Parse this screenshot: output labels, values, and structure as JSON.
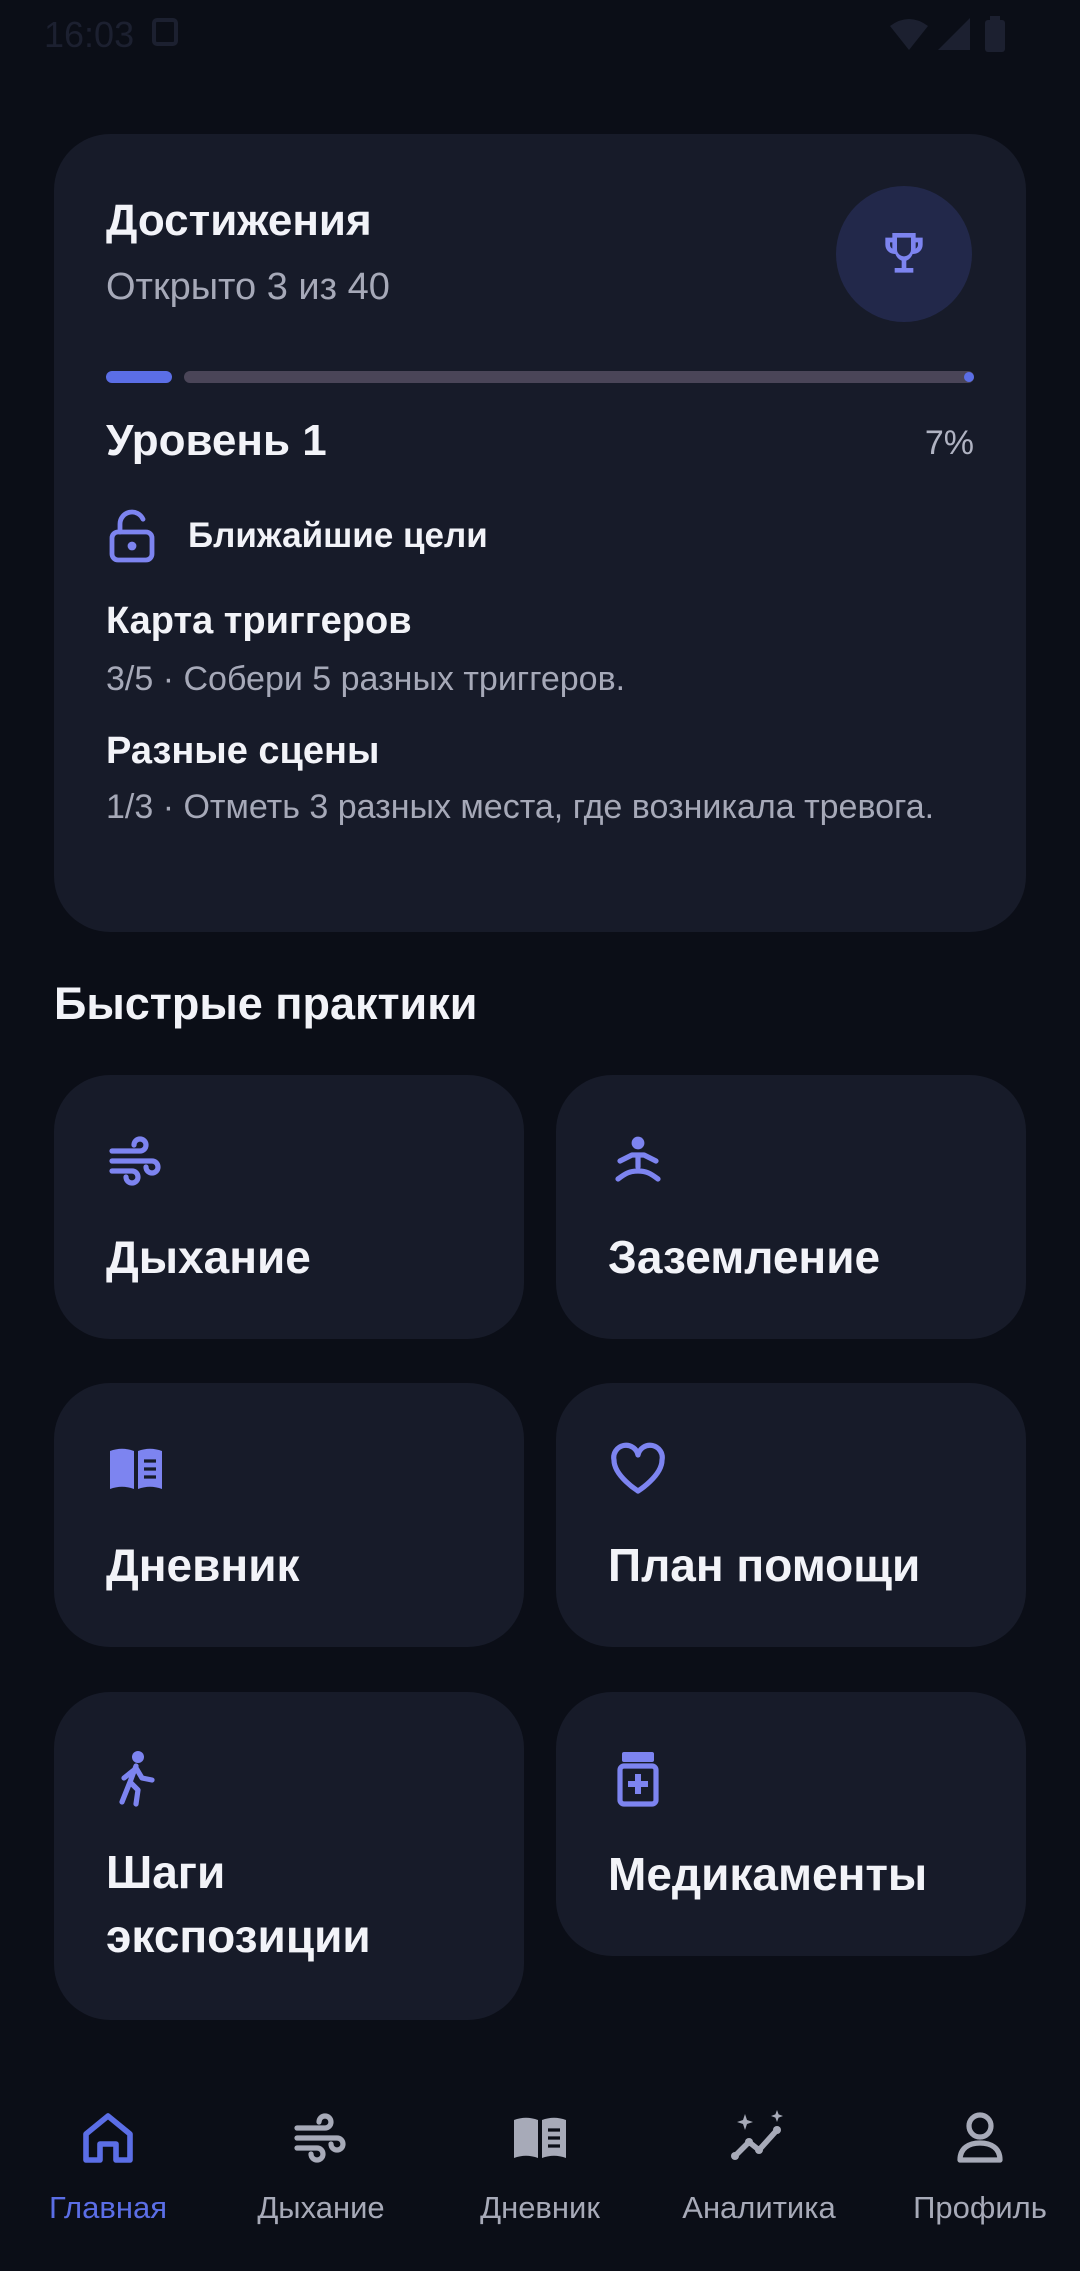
{
  "status_bar": {
    "time": "16:03"
  },
  "achievements": {
    "title": "Достижения",
    "subtitle": "Открыто 3 из 40",
    "progress_percent": 7,
    "level": "Уровень 1",
    "percent_label": "7%",
    "goals_heading": "Ближайшие цели",
    "goals": [
      {
        "title": "Карта триггеров",
        "desc": "3/5 · Собери 5 разных триггеров."
      },
      {
        "title": "Разные сцены",
        "desc": "1/3 · Отметь 3 разных места, где возникала тревога."
      }
    ]
  },
  "quick_practices": {
    "title": "Быстрые практики",
    "tiles": [
      {
        "label": "Дыхание",
        "icon": "wind-icon"
      },
      {
        "label": "Заземление",
        "icon": "meditation-icon"
      },
      {
        "label": "Дневник",
        "icon": "book-icon"
      },
      {
        "label": "План помощи",
        "icon": "heart-icon"
      },
      {
        "label": "Шаги экспозиции",
        "icon": "walking-icon"
      },
      {
        "label": "Медикаменты",
        "icon": "medication-icon"
      }
    ]
  },
  "bottom_nav": {
    "items": [
      {
        "label": "Главная",
        "icon": "home-icon",
        "active": true
      },
      {
        "label": "Дыхание",
        "icon": "wind-icon",
        "active": false
      },
      {
        "label": "Дневник",
        "icon": "book-icon",
        "active": false
      },
      {
        "label": "Аналитика",
        "icon": "analytics-icon",
        "active": false
      },
      {
        "label": "Профиль",
        "icon": "profile-icon",
        "active": false
      }
    ]
  },
  "colors": {
    "background": "#0b0e17",
    "card": "#171b29",
    "accent": "#5b6ee6",
    "icon_accent": "#7d84f0",
    "text_primary": "#f2f3f8",
    "text_secondary": "#a6a9b8"
  }
}
